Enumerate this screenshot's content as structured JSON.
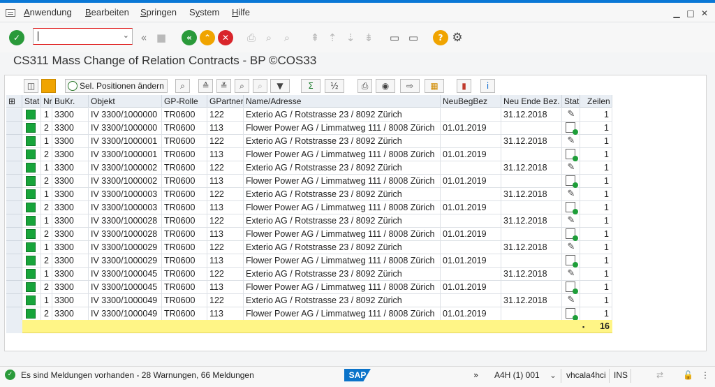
{
  "menu": {
    "items": [
      "Anwendung",
      "Bearbeiten",
      "Springen",
      "System",
      "Hilfe"
    ],
    "underlines": [
      "A",
      "B",
      "S",
      "y",
      "H"
    ]
  },
  "title": "CS311 Mass Change of Relation Contracts - BP ©COS33",
  "command_field": {
    "value": ""
  },
  "alv_toolbar": {
    "sel_button": "Sel. Positionen ändern"
  },
  "columns": [
    "Stat",
    "Nr",
    "BuKr.",
    "Objekt",
    "GP-Rolle",
    "GPartner",
    "Name/Adresse",
    "NeuBegBez",
    "Neu Ende Bez.",
    "Stat",
    "Zeilen"
  ],
  "rows": [
    {
      "nr": "1",
      "bukr": "3300",
      "objekt": "IV 3300/1000000",
      "rolle": "TR0600",
      "gp": "122",
      "name": "Exterio AG / Rotstrasse 23 / 8092 Zürich",
      "beg": "",
      "ende": "31.12.2018",
      "action": "edit",
      "zeilen": "1"
    },
    {
      "nr": "2",
      "bukr": "3300",
      "objekt": "IV 3300/1000000",
      "rolle": "TR0600",
      "gp": "113",
      "name": "Flower Power AG / Limmatweg 111 / 8008 Zürich",
      "beg": "01.01.2019",
      "ende": "",
      "action": "new",
      "zeilen": "1"
    },
    {
      "nr": "1",
      "bukr": "3300",
      "objekt": "IV 3300/1000001",
      "rolle": "TR0600",
      "gp": "122",
      "name": "Exterio AG / Rotstrasse 23 / 8092 Zürich",
      "beg": "",
      "ende": "31.12.2018",
      "action": "edit",
      "zeilen": "1"
    },
    {
      "nr": "2",
      "bukr": "3300",
      "objekt": "IV 3300/1000001",
      "rolle": "TR0600",
      "gp": "113",
      "name": "Flower Power AG / Limmatweg 111 / 8008 Zürich",
      "beg": "01.01.2019",
      "ende": "",
      "action": "new",
      "zeilen": "1"
    },
    {
      "nr": "1",
      "bukr": "3300",
      "objekt": "IV 3300/1000002",
      "rolle": "TR0600",
      "gp": "122",
      "name": "Exterio AG / Rotstrasse 23 / 8092 Zürich",
      "beg": "",
      "ende": "31.12.2018",
      "action": "edit",
      "zeilen": "1"
    },
    {
      "nr": "2",
      "bukr": "3300",
      "objekt": "IV 3300/1000002",
      "rolle": "TR0600",
      "gp": "113",
      "name": "Flower Power AG / Limmatweg 111 / 8008 Zürich",
      "beg": "01.01.2019",
      "ende": "",
      "action": "new",
      "zeilen": "1"
    },
    {
      "nr": "1",
      "bukr": "3300",
      "objekt": "IV 3300/1000003",
      "rolle": "TR0600",
      "gp": "122",
      "name": "Exterio AG / Rotstrasse 23 / 8092 Zürich",
      "beg": "",
      "ende": "31.12.2018",
      "action": "edit",
      "zeilen": "1"
    },
    {
      "nr": "2",
      "bukr": "3300",
      "objekt": "IV 3300/1000003",
      "rolle": "TR0600",
      "gp": "113",
      "name": "Flower Power AG / Limmatweg 111 / 8008 Zürich",
      "beg": "01.01.2019",
      "ende": "",
      "action": "new",
      "zeilen": "1"
    },
    {
      "nr": "1",
      "bukr": "3300",
      "objekt": "IV 3300/1000028",
      "rolle": "TR0600",
      "gp": "122",
      "name": "Exterio AG / Rotstrasse 23 / 8092 Zürich",
      "beg": "",
      "ende": "31.12.2018",
      "action": "edit",
      "zeilen": "1"
    },
    {
      "nr": "2",
      "bukr": "3300",
      "objekt": "IV 3300/1000028",
      "rolle": "TR0600",
      "gp": "113",
      "name": "Flower Power AG / Limmatweg 111 / 8008 Zürich",
      "beg": "01.01.2019",
      "ende": "",
      "action": "new",
      "zeilen": "1"
    },
    {
      "nr": "1",
      "bukr": "3300",
      "objekt": "IV 3300/1000029",
      "rolle": "TR0600",
      "gp": "122",
      "name": "Exterio AG / Rotstrasse 23 / 8092 Zürich",
      "beg": "",
      "ende": "31.12.2018",
      "action": "edit",
      "zeilen": "1"
    },
    {
      "nr": "2",
      "bukr": "3300",
      "objekt": "IV 3300/1000029",
      "rolle": "TR0600",
      "gp": "113",
      "name": "Flower Power AG / Limmatweg 111 / 8008 Zürich",
      "beg": "01.01.2019",
      "ende": "",
      "action": "new",
      "zeilen": "1"
    },
    {
      "nr": "1",
      "bukr": "3300",
      "objekt": "IV 3300/1000045",
      "rolle": "TR0600",
      "gp": "122",
      "name": "Exterio AG / Rotstrasse 23 / 8092 Zürich",
      "beg": "",
      "ende": "31.12.2018",
      "action": "edit",
      "zeilen": "1"
    },
    {
      "nr": "2",
      "bukr": "3300",
      "objekt": "IV 3300/1000045",
      "rolle": "TR0600",
      "gp": "113",
      "name": "Flower Power AG / Limmatweg 111 / 8008 Zürich",
      "beg": "01.01.2019",
      "ende": "",
      "action": "new",
      "zeilen": "1"
    },
    {
      "nr": "1",
      "bukr": "3300",
      "objekt": "IV 3300/1000049",
      "rolle": "TR0600",
      "gp": "122",
      "name": "Exterio AG / Rotstrasse 23 / 8092 Zürich",
      "beg": "",
      "ende": "31.12.2018",
      "action": "edit",
      "zeilen": "1"
    },
    {
      "nr": "2",
      "bukr": "3300",
      "objekt": "IV 3300/1000049",
      "rolle": "TR0600",
      "gp": "113",
      "name": "Flower Power AG / Limmatweg 111 / 8008 Zürich",
      "beg": "01.01.2019",
      "ende": "",
      "action": "new",
      "zeilen": "1"
    }
  ],
  "sum": {
    "marker": "▪",
    "total": "16"
  },
  "statusbar": {
    "message": "Es sind Meldungen vorhanden - 28 Warnungen, 66 Meldungen",
    "logo": "SAP",
    "system": "A4H (1) 001",
    "host": "vhcala4hci",
    "mode": "INS"
  },
  "colors": {
    "accent": "#0a78d6",
    "status_green": "#17a43a",
    "sum_row": "#fff586",
    "header_bg": "#e9eef4"
  },
  "icons": {
    "enter": "check-icon",
    "back": "back-icon",
    "exit": "exit-icon",
    "cancel": "cancel-icon",
    "help": "help-icon",
    "settings": "gear-icon"
  }
}
